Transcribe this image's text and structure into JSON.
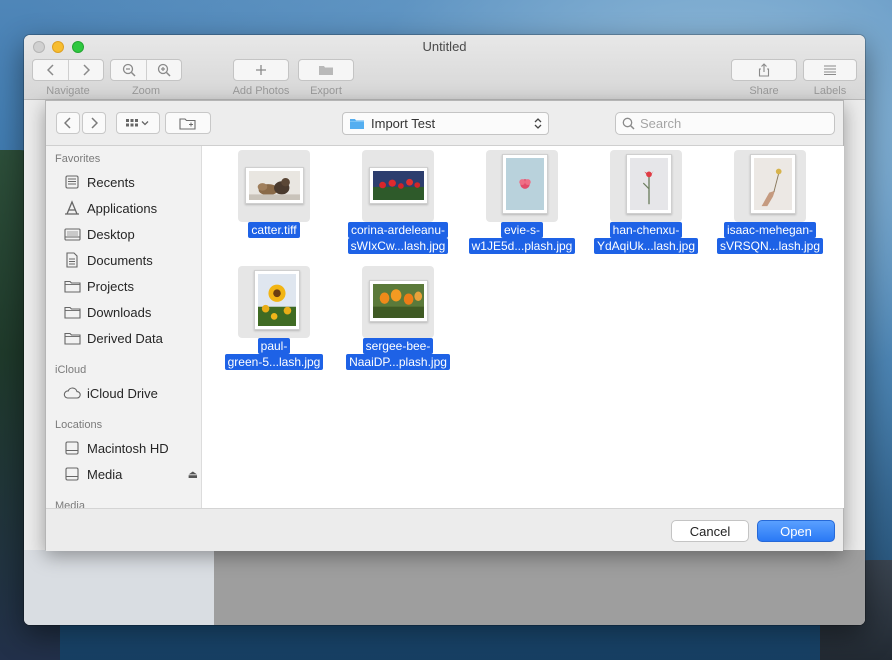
{
  "window": {
    "title": "Untitled",
    "toolbar": {
      "navigate_label": "Navigate",
      "zoom_label": "Zoom",
      "add_photos_label": "Add Photos",
      "export_label": "Export",
      "share_label": "Share",
      "labels_label": "Labels"
    }
  },
  "dialog": {
    "location": "Import Test",
    "search_placeholder": "Search",
    "cancel_label": "Cancel",
    "open_label": "Open"
  },
  "sidebar": {
    "favorites_heading": "Favorites",
    "favorites": [
      {
        "label": "Recents",
        "icon": "recents-icon"
      },
      {
        "label": "Applications",
        "icon": "applications-icon"
      },
      {
        "label": "Desktop",
        "icon": "desktop-icon"
      },
      {
        "label": "Documents",
        "icon": "documents-icon"
      },
      {
        "label": "Projects",
        "icon": "folder-icon"
      },
      {
        "label": "Downloads",
        "icon": "folder-icon"
      },
      {
        "label": "Derived Data",
        "icon": "folder-icon"
      }
    ],
    "icloud_heading": "iCloud",
    "icloud": [
      {
        "label": "iCloud Drive",
        "icon": "cloud-icon"
      }
    ],
    "locations_heading": "Locations",
    "locations": [
      {
        "label": "Macintosh HD",
        "icon": "disk-icon"
      },
      {
        "label": "Media",
        "icon": "disk-icon",
        "eject": "⏏"
      }
    ],
    "media_heading": "Media"
  },
  "files": [
    {
      "line1": "catter.tiff",
      "line2": "",
      "thumb": "cats-photo"
    },
    {
      "line1": "corina-ardeleanu-",
      "line2": "sWIxCw...lash.jpg",
      "thumb": "tulips-photo"
    },
    {
      "line1": "evie-s-",
      "line2": "w1JE5d...plash.jpg",
      "thumb": "pink-flower-photo"
    },
    {
      "line1": "han-chenxu-",
      "line2": "YdAqiUk...lash.jpg",
      "thumb": "single-flower-photo"
    },
    {
      "line1": "isaac-mehegan-",
      "line2": "sVRSQN...lash.jpg",
      "thumb": "hand-flower-photo"
    },
    {
      "line1": "paul-",
      "line2": "green-5...lash.jpg",
      "thumb": "sunflower-photo"
    },
    {
      "line1": "sergee-bee-",
      "line2": "NaaiDP...plash.jpg",
      "thumb": "orange-tulips-photo"
    }
  ],
  "colors": {
    "selection": "#1e62e6",
    "accent": "#2a79f5"
  }
}
